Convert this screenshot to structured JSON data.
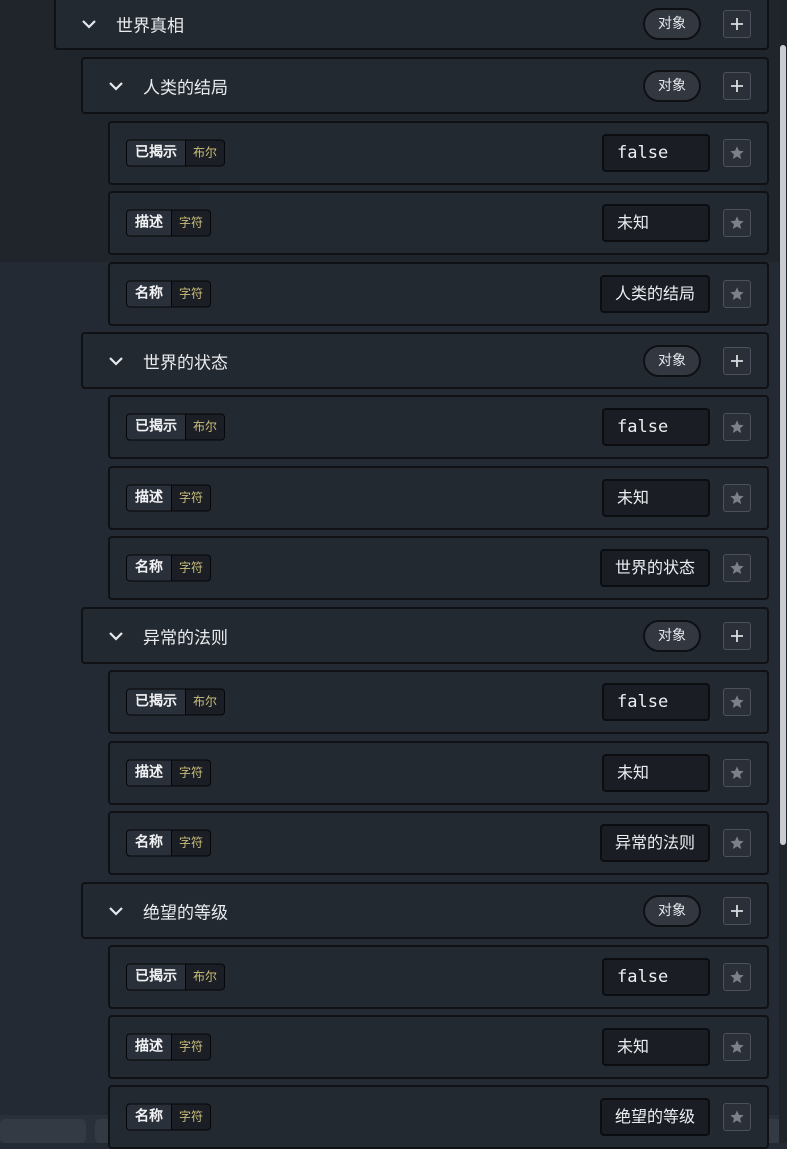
{
  "groups": [
    {
      "title": "世界真相",
      "type": "对象"
    },
    {
      "title": "人类的结局",
      "type": "对象"
    },
    {
      "title": "世界的状态",
      "type": "对象"
    },
    {
      "title": "异常的法则",
      "type": "对象"
    },
    {
      "title": "绝望的等级",
      "type": "对象"
    }
  ],
  "props": [
    {
      "name": "已揭示",
      "kind": "布尔",
      "value": "false"
    },
    {
      "name": "描述",
      "kind": "字符",
      "value": "未知"
    },
    {
      "name": "名称",
      "kind": "字符",
      "value": "人类的结局"
    },
    {
      "name": "已揭示",
      "kind": "布尔",
      "value": "false"
    },
    {
      "name": "描述",
      "kind": "字符",
      "value": "未知"
    },
    {
      "name": "名称",
      "kind": "字符",
      "value": "世界的状态"
    },
    {
      "name": "已揭示",
      "kind": "布尔",
      "value": "false"
    },
    {
      "name": "描述",
      "kind": "字符",
      "value": "未知"
    },
    {
      "name": "名称",
      "kind": "字符",
      "value": "异常的法则"
    },
    {
      "name": "已揭示",
      "kind": "布尔",
      "value": "false"
    },
    {
      "name": "描述",
      "kind": "字符",
      "value": "未知"
    },
    {
      "name": "名称",
      "kind": "字符",
      "value": "绝望的等级"
    }
  ],
  "icons": {
    "expand": "chevron-down-icon",
    "add": "plus-icon",
    "favorite": "star-icon"
  },
  "colors": {
    "background": "#242a33",
    "row": "#232930",
    "type_text": "#cbbf7b"
  }
}
